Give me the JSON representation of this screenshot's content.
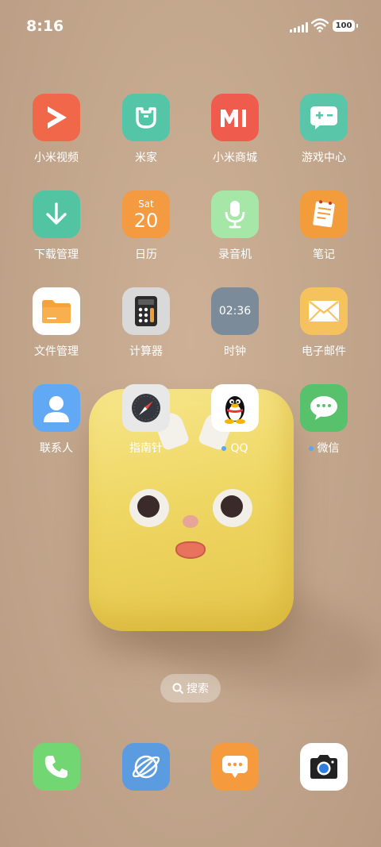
{
  "status_bar": {
    "time": "8:16",
    "battery": "100"
  },
  "rows": [
    [
      {
        "label": "小米视频",
        "color": "#f0674a",
        "icon": "play-icon"
      },
      {
        "label": "米家",
        "color": "#55c5a8",
        "icon": "mijia-icon"
      },
      {
        "label": "小米商城",
        "color": "#ef5b4d",
        "icon": "mi-logo-icon"
      },
      {
        "label": "游戏中心",
        "color": "#59c6aa",
        "icon": "gamepad-icon"
      }
    ],
    [
      {
        "label": "下载管理",
        "color": "#52c4a2",
        "icon": "download-icon"
      },
      {
        "label": "日历",
        "color": "#f49a40",
        "icon": "calendar-icon",
        "weekday": "Sat",
        "day": "20"
      },
      {
        "label": "录音机",
        "color": "#a6e7a8",
        "icon": "microphone-icon"
      },
      {
        "label": "笔记",
        "color": "#f39c3c",
        "icon": "notes-icon"
      }
    ],
    [
      {
        "label": "文件管理",
        "color": "#ffffff",
        "icon": "folder-icon"
      },
      {
        "label": "计算器",
        "color": "#d9d9d9",
        "icon": "calculator-icon"
      },
      {
        "label": "时钟",
        "color": "#7b8b99",
        "icon": "clock-icon",
        "clock_text": "02:36"
      },
      {
        "label": "电子邮件",
        "color": "#f6c25e",
        "icon": "envelope-icon"
      }
    ],
    [
      {
        "label": "联系人",
        "color": "#62a9f5",
        "icon": "person-icon"
      },
      {
        "label": "指南针",
        "color": "#e8e8e8",
        "icon": "compass-icon"
      },
      {
        "label": "QQ",
        "color": "#ffffff",
        "icon": "qq-penguin-icon",
        "dot": true
      },
      {
        "label": "微信",
        "color": "#57c16b",
        "icon": "wechat-icon",
        "dot": true
      }
    ]
  ],
  "search": {
    "label": "搜索"
  },
  "dock": [
    {
      "name": "phone",
      "color": "#72d672",
      "icon": "phone-icon"
    },
    {
      "name": "browser",
      "color": "#5b9ce0",
      "icon": "browser-icon"
    },
    {
      "name": "messages",
      "color": "#f59a3d",
      "icon": "message-icon"
    },
    {
      "name": "camera",
      "color": "#ffffff",
      "icon": "camera-icon"
    }
  ]
}
